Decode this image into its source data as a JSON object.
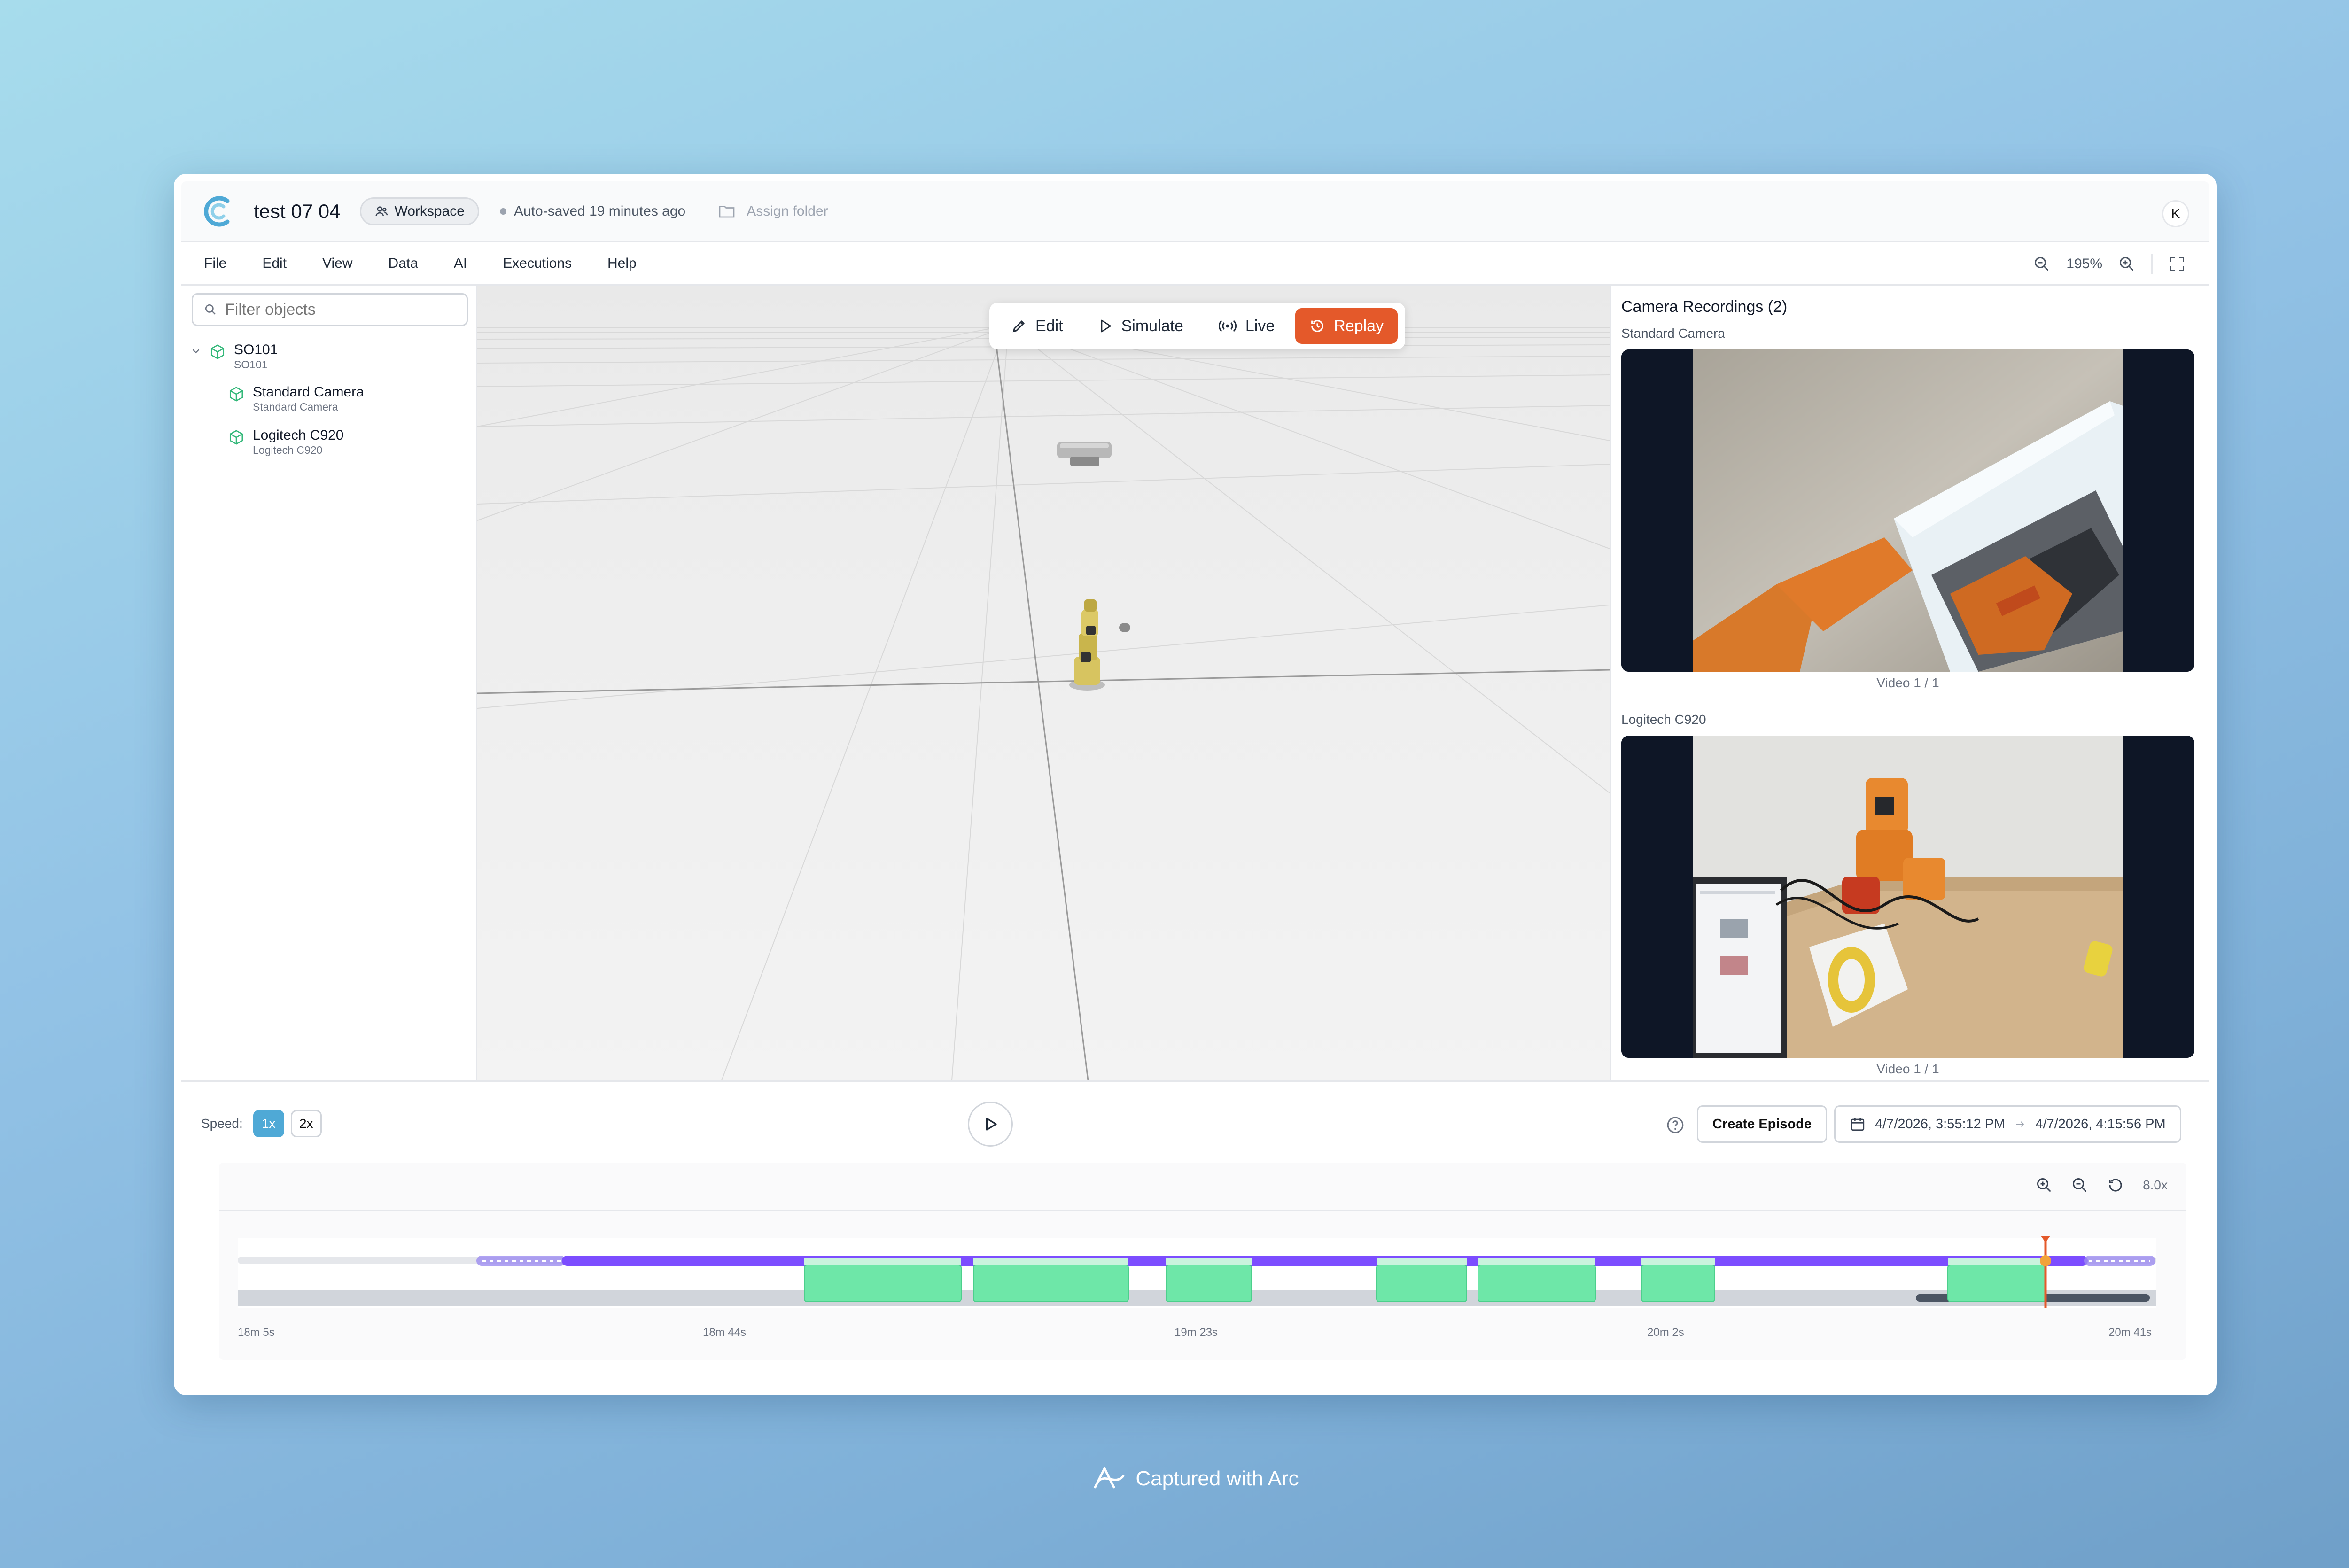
{
  "header": {
    "title": "test 07 04",
    "workspace_label": "Workspace",
    "autosave": "Auto-saved 19 minutes ago",
    "assign_folder": "Assign folder",
    "avatar_initial": "K"
  },
  "menu": [
    "File",
    "Edit",
    "View",
    "Data",
    "AI",
    "Executions",
    "Help"
  ],
  "zoom": {
    "level": "195%"
  },
  "sidebar": {
    "filter_placeholder": "Filter objects",
    "items": [
      {
        "name": "SO101",
        "sub": "SO101"
      },
      {
        "name": "Standard Camera",
        "sub": "Standard Camera"
      },
      {
        "name": "Logitech C920",
        "sub": "Logitech C920"
      }
    ]
  },
  "modes": {
    "edit": "Edit",
    "simulate": "Simulate",
    "live": "Live",
    "replay": "Replay",
    "active": "Replay"
  },
  "recordings": {
    "title": "Camera Recordings (2)",
    "cameras": [
      {
        "name": "Standard Camera",
        "caption": "Video 1 / 1"
      },
      {
        "name": "Logitech C920",
        "caption": "Video 1 / 1"
      }
    ]
  },
  "playback": {
    "speed_label": "Speed:",
    "speed_1x": "1x",
    "speed_2x": "2x",
    "active_speed": "1x",
    "create_episode": "Create Episode",
    "start": "4/7/2026, 3:55:12 PM",
    "end": "4/7/2026, 4:15:56 PM",
    "timeline_zoom": "8.0x",
    "ticks": [
      "18m 5s",
      "18m 44s",
      "19m 23s",
      "20m 2s",
      "20m 41s"
    ]
  },
  "colors": {
    "accent": "#e4592a",
    "speed_active": "#4fa9d6",
    "track": "#7c4dff",
    "episode": "#6ee7a8"
  },
  "footer": {
    "watermark": "Captured with Arc"
  }
}
